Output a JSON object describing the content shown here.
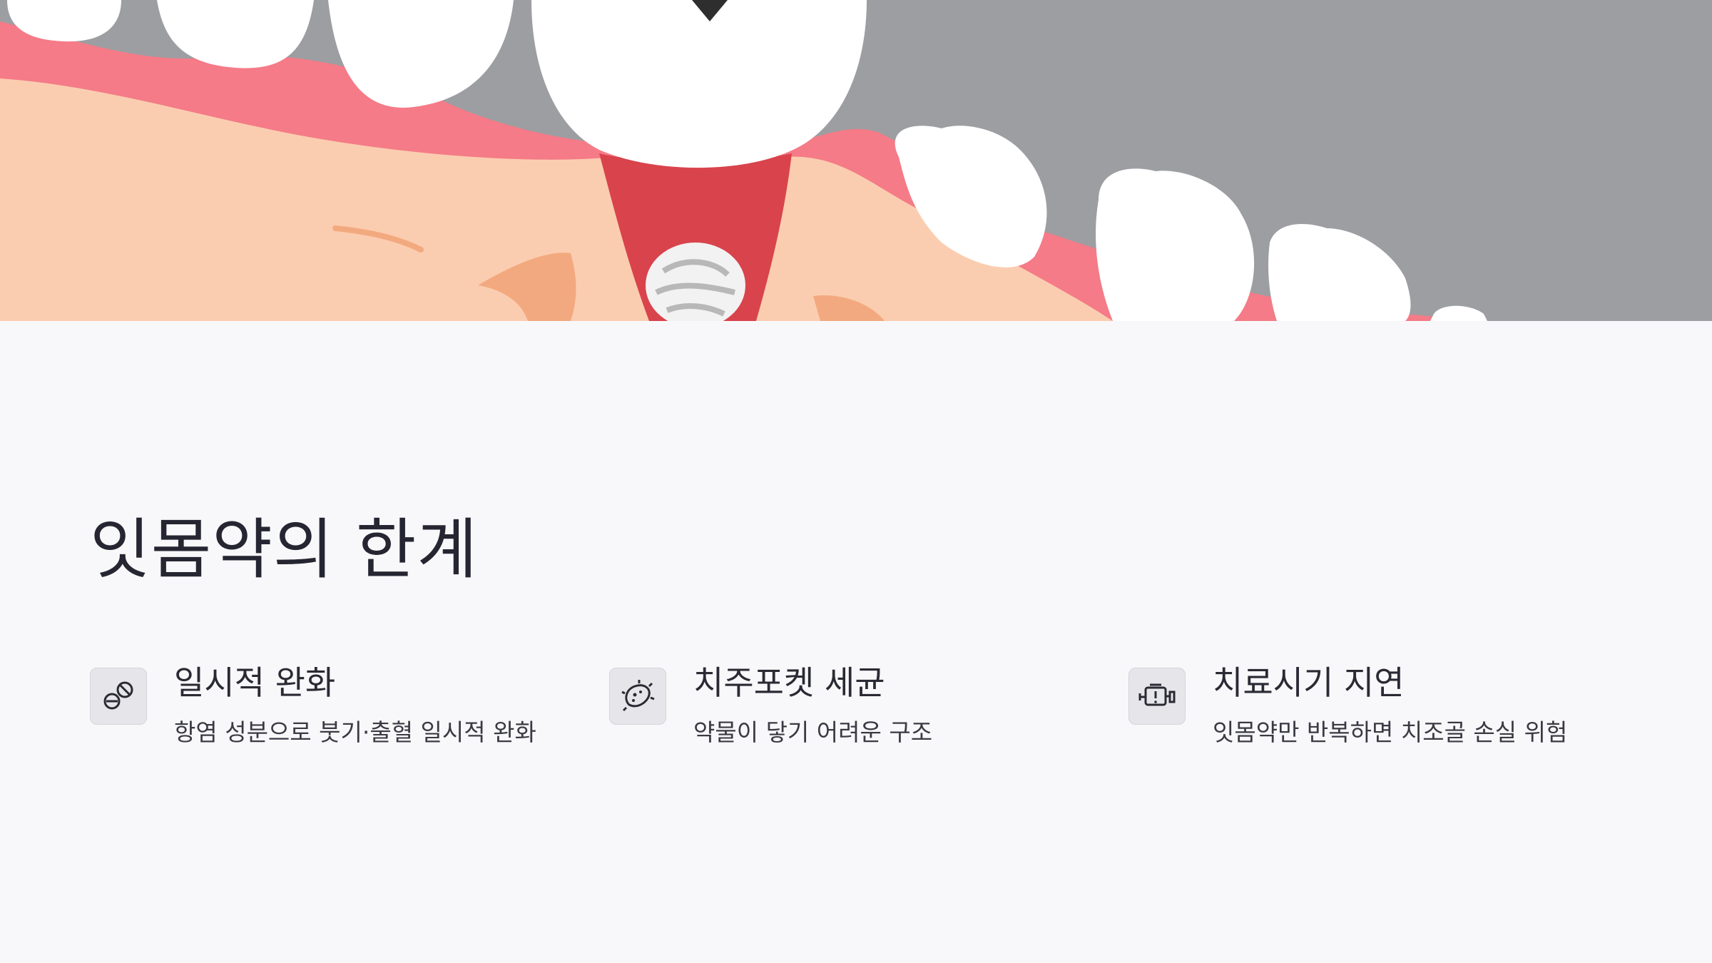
{
  "slide": {
    "title": "잇몸약의 한계",
    "colors": {
      "background": "#f8f8fa",
      "title": "#262632",
      "icon_box": "#e6e6ea",
      "gum": "#f47b87",
      "tissue": "#fbcdb0",
      "tooth": "#ffffff",
      "backdrop": "#9c9ea2"
    },
    "hero_image": {
      "icon": "tooth-gum-illustration"
    },
    "cards": [
      {
        "icon": "pill-cancel-icon",
        "title": "일시적 완화",
        "description": "항염 성분으로 붓기·출혈 일시적 완화"
      },
      {
        "icon": "bacteria-icon",
        "title": "치주포켓 세균",
        "description": "약물이 닿기 어려운 구조"
      },
      {
        "icon": "engine-warning-icon",
        "title": "치료시기 지연",
        "description": "잇몸약만 반복하면 치조골 손실 위험"
      }
    ]
  }
}
